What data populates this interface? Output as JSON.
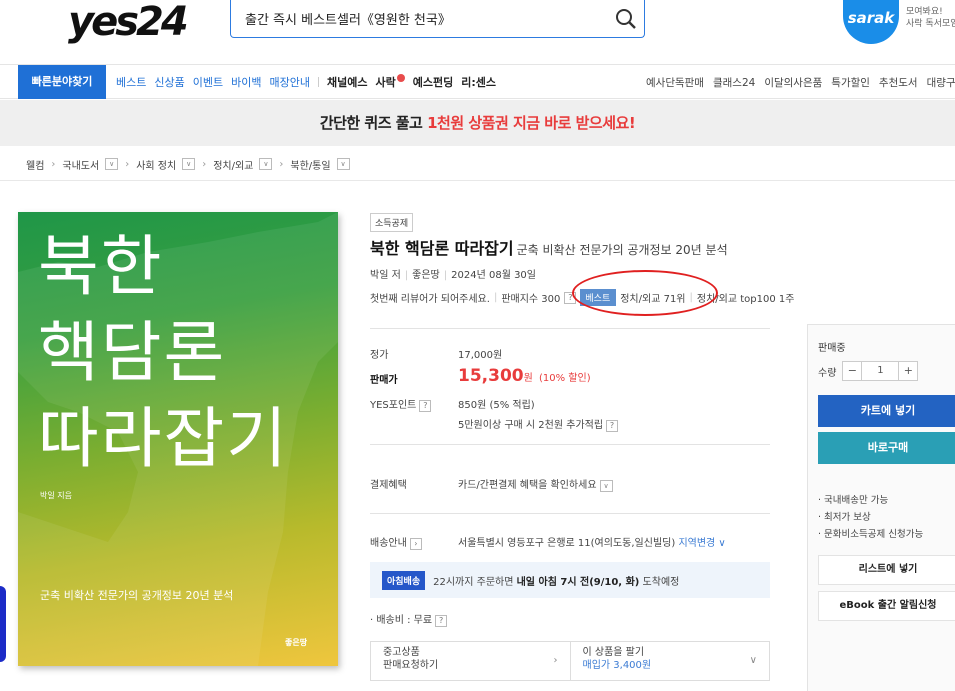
{
  "header": {
    "logo": "yes24",
    "search_value": "출간 즉시 베스트셀러《영원한 천국》",
    "sarak_logo": "sarak",
    "sarak_msg_1": "모여봐요!",
    "sarak_msg_2": "사락 독서모임"
  },
  "nav": {
    "quick": "빠른분야찾기",
    "blue_items": [
      "베스트",
      "신상품",
      "이벤트",
      "바이백",
      "매장안내"
    ],
    "black_items": [
      "채널예스",
      "사락",
      "예스펀딩",
      "리:센스"
    ],
    "right_items": [
      "예사단독판매",
      "클래스24",
      "이달의사은품",
      "특가할인",
      "추천도서",
      "대량구매"
    ]
  },
  "banner": {
    "part1": "간단한 퀴즈 풀고 ",
    "highlight": "1천원 상품권 지금 바로 받으세요!"
  },
  "breadcrumb": [
    "웰컴",
    "국내도서",
    "사회 정치",
    "정치/외교",
    "북한/통일"
  ],
  "cover": {
    "title_line1": "북한",
    "title_line2": "핵담론",
    "title_line3": "따라잡기",
    "author": "박일 지음",
    "subtitle": "군축 비확산 전문가의 공개정보 20년 분석",
    "publisher": "좋은땅"
  },
  "product": {
    "tag": "소득공제",
    "title": "북한 핵담론 따라잡기",
    "subtitle": "군축 비확산 전문가의 공개정보 20년 분석",
    "author": "박일 저",
    "publisher": "좋은땅",
    "date": "2024년 08월 30일",
    "review_cta": "첫번째 리뷰어가 되어주세요.",
    "sales_index": "판매지수 300",
    "best_badge": "베스트",
    "best_rank": "정치/외교 71위",
    "top100": "정치/외교 top100 1주",
    "list_price_label": "정가",
    "list_price": "17,000원",
    "sale_price_label": "판매가",
    "sale_price": "15,300",
    "sale_unit": "원",
    "discount": "(10% 할인)",
    "points_label": "YES포인트",
    "points": "850원 (5% 적립)",
    "points_extra": "5만원이상 구매 시 2천원 추가적립",
    "payment_label": "결제혜택",
    "payment": "카드/간편결제 혜택을 확인하세요",
    "delivery_label": "배송안내",
    "delivery_address": "서울특별시 영등포구 은행로 11(여의도동,일신빌딩)",
    "region_change": "지역변경",
    "morning_badge": "아침배송",
    "morning_text_1": "22시까지 주문하면 ",
    "morning_text_bold": "내일 아침 7시 전(9/10, 화)",
    "morning_text_2": " 도착예정",
    "shipping_fee": "· 배송비 : 무료",
    "used_title": "중고상품",
    "used_sub": "판매요청하기",
    "sell_title": "이 상품을 팔기",
    "sell_sub": "매입가 3,400원"
  },
  "buy_panel": {
    "status": "판매중",
    "qty_label": "수량",
    "qty_value": "1",
    "cart": "카트에 넣기",
    "buy": "바로구매",
    "benefits": [
      "· 국내배송만 가능",
      "· 최저가 보상",
      "· 문화비소득공제 신청가능"
    ],
    "list_add": "리스트에 넣기",
    "ebook_alert": "eBook 출간 알림신청"
  }
}
